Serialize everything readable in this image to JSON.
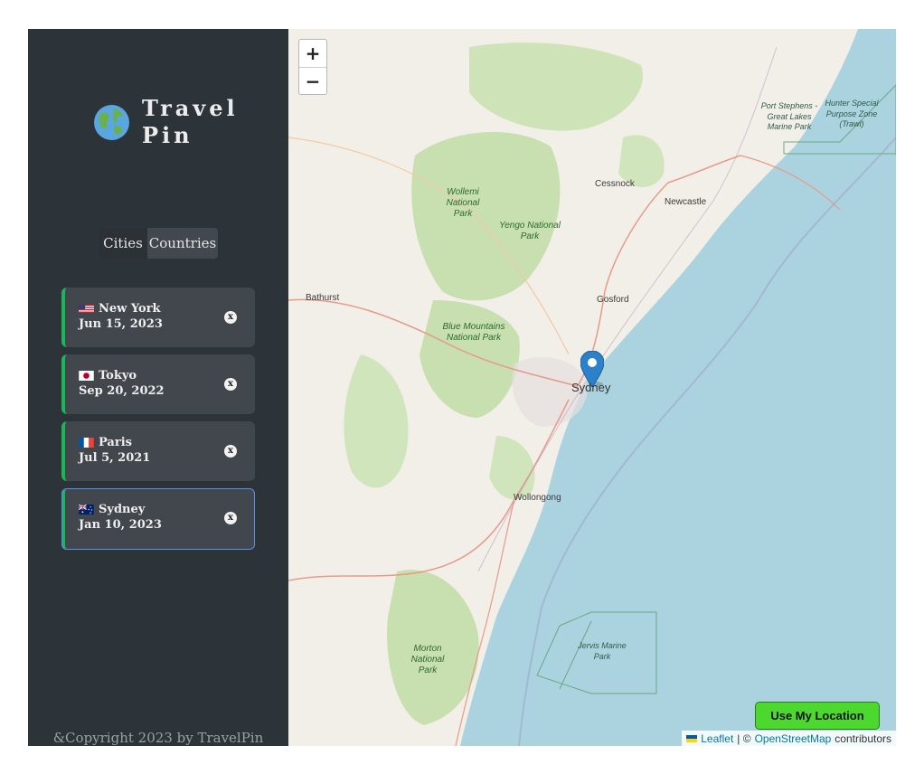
{
  "app": {
    "logo_text": "Travel Pin",
    "logo_icon": "globe-icon"
  },
  "tabs": [
    {
      "label": "Cities",
      "active": true
    },
    {
      "label": "Countries",
      "active": false
    }
  ],
  "cities": [
    {
      "name": "New York",
      "date": "Jun 15, 2023",
      "flag": "us-flag-icon",
      "delete_label": "x"
    },
    {
      "name": "Tokyo",
      "date": "Sep 20, 2022",
      "flag": "jp-flag-icon",
      "delete_label": "x"
    },
    {
      "name": "Paris",
      "date": "Jul 5, 2021",
      "flag": "fr-flag-icon",
      "delete_label": "x"
    },
    {
      "name": "Sydney",
      "date": "Jan 10, 2023",
      "flag": "au-flag-icon",
      "delete_label": "x",
      "selected": true
    }
  ],
  "footer": {
    "copyright": "&Copyright 2023 by TravelPin"
  },
  "map": {
    "zoom_in": "+",
    "zoom_out": "−",
    "marker_label": "Sydney",
    "place_labels": {
      "cessnock": "Cessnock",
      "newcastle": "Newcastle",
      "gosford": "Gosford",
      "bathurst": "Bathurst",
      "wollongong": "Wollongong"
    },
    "park_labels": {
      "wollemi": "Wollemi National Park",
      "yengo": "Yengo National Park",
      "blue_mountains": "Blue Mountains National Park",
      "morton": "Morton National Park"
    },
    "marine_labels": {
      "port_stephens": "Port Stephens - Great Lakes Marine Park",
      "hunter": "Hunter Special Purpose Zone (Trawl)",
      "jervis": "Jervis Marine Park"
    },
    "use_location_label": "Use My Location",
    "attribution": {
      "leaflet": "Leaflet",
      "separator": "| ©",
      "osm": "OpenStreetMap",
      "suffix": "contributors"
    }
  },
  "colors": {
    "sidebar_bg": "#2d3439",
    "card_bg": "#41474c",
    "card_accent": "#1fb35a",
    "selected_outline": "#5b8ee8",
    "location_button": "#4cd82e",
    "sea": "#aad3df",
    "land": "#f2efe9",
    "park": "#c8dfb0"
  }
}
